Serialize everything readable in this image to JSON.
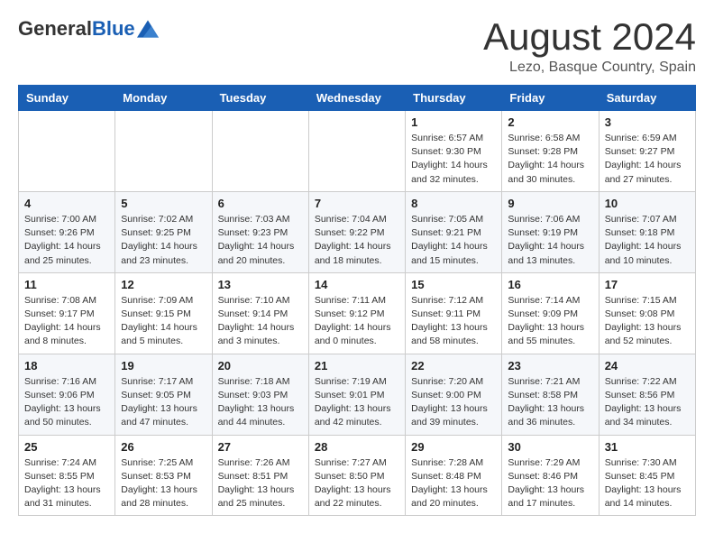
{
  "logo": {
    "general": "General",
    "blue": "Blue"
  },
  "title": "August 2024",
  "location": "Lezo, Basque Country, Spain",
  "days_header": [
    "Sunday",
    "Monday",
    "Tuesday",
    "Wednesday",
    "Thursday",
    "Friday",
    "Saturday"
  ],
  "weeks": [
    [
      {
        "day": "",
        "info": ""
      },
      {
        "day": "",
        "info": ""
      },
      {
        "day": "",
        "info": ""
      },
      {
        "day": "",
        "info": ""
      },
      {
        "day": "1",
        "info": "Sunrise: 6:57 AM\nSunset: 9:30 PM\nDaylight: 14 hours\nand 32 minutes."
      },
      {
        "day": "2",
        "info": "Sunrise: 6:58 AM\nSunset: 9:28 PM\nDaylight: 14 hours\nand 30 minutes."
      },
      {
        "day": "3",
        "info": "Sunrise: 6:59 AM\nSunset: 9:27 PM\nDaylight: 14 hours\nand 27 minutes."
      }
    ],
    [
      {
        "day": "4",
        "info": "Sunrise: 7:00 AM\nSunset: 9:26 PM\nDaylight: 14 hours\nand 25 minutes."
      },
      {
        "day": "5",
        "info": "Sunrise: 7:02 AM\nSunset: 9:25 PM\nDaylight: 14 hours\nand 23 minutes."
      },
      {
        "day": "6",
        "info": "Sunrise: 7:03 AM\nSunset: 9:23 PM\nDaylight: 14 hours\nand 20 minutes."
      },
      {
        "day": "7",
        "info": "Sunrise: 7:04 AM\nSunset: 9:22 PM\nDaylight: 14 hours\nand 18 minutes."
      },
      {
        "day": "8",
        "info": "Sunrise: 7:05 AM\nSunset: 9:21 PM\nDaylight: 14 hours\nand 15 minutes."
      },
      {
        "day": "9",
        "info": "Sunrise: 7:06 AM\nSunset: 9:19 PM\nDaylight: 14 hours\nand 13 minutes."
      },
      {
        "day": "10",
        "info": "Sunrise: 7:07 AM\nSunset: 9:18 PM\nDaylight: 14 hours\nand 10 minutes."
      }
    ],
    [
      {
        "day": "11",
        "info": "Sunrise: 7:08 AM\nSunset: 9:17 PM\nDaylight: 14 hours\nand 8 minutes."
      },
      {
        "day": "12",
        "info": "Sunrise: 7:09 AM\nSunset: 9:15 PM\nDaylight: 14 hours\nand 5 minutes."
      },
      {
        "day": "13",
        "info": "Sunrise: 7:10 AM\nSunset: 9:14 PM\nDaylight: 14 hours\nand 3 minutes."
      },
      {
        "day": "14",
        "info": "Sunrise: 7:11 AM\nSunset: 9:12 PM\nDaylight: 14 hours\nand 0 minutes."
      },
      {
        "day": "15",
        "info": "Sunrise: 7:12 AM\nSunset: 9:11 PM\nDaylight: 13 hours\nand 58 minutes."
      },
      {
        "day": "16",
        "info": "Sunrise: 7:14 AM\nSunset: 9:09 PM\nDaylight: 13 hours\nand 55 minutes."
      },
      {
        "day": "17",
        "info": "Sunrise: 7:15 AM\nSunset: 9:08 PM\nDaylight: 13 hours\nand 52 minutes."
      }
    ],
    [
      {
        "day": "18",
        "info": "Sunrise: 7:16 AM\nSunset: 9:06 PM\nDaylight: 13 hours\nand 50 minutes."
      },
      {
        "day": "19",
        "info": "Sunrise: 7:17 AM\nSunset: 9:05 PM\nDaylight: 13 hours\nand 47 minutes."
      },
      {
        "day": "20",
        "info": "Sunrise: 7:18 AM\nSunset: 9:03 PM\nDaylight: 13 hours\nand 44 minutes."
      },
      {
        "day": "21",
        "info": "Sunrise: 7:19 AM\nSunset: 9:01 PM\nDaylight: 13 hours\nand 42 minutes."
      },
      {
        "day": "22",
        "info": "Sunrise: 7:20 AM\nSunset: 9:00 PM\nDaylight: 13 hours\nand 39 minutes."
      },
      {
        "day": "23",
        "info": "Sunrise: 7:21 AM\nSunset: 8:58 PM\nDaylight: 13 hours\nand 36 minutes."
      },
      {
        "day": "24",
        "info": "Sunrise: 7:22 AM\nSunset: 8:56 PM\nDaylight: 13 hours\nand 34 minutes."
      }
    ],
    [
      {
        "day": "25",
        "info": "Sunrise: 7:24 AM\nSunset: 8:55 PM\nDaylight: 13 hours\nand 31 minutes."
      },
      {
        "day": "26",
        "info": "Sunrise: 7:25 AM\nSunset: 8:53 PM\nDaylight: 13 hours\nand 28 minutes."
      },
      {
        "day": "27",
        "info": "Sunrise: 7:26 AM\nSunset: 8:51 PM\nDaylight: 13 hours\nand 25 minutes."
      },
      {
        "day": "28",
        "info": "Sunrise: 7:27 AM\nSunset: 8:50 PM\nDaylight: 13 hours\nand 22 minutes."
      },
      {
        "day": "29",
        "info": "Sunrise: 7:28 AM\nSunset: 8:48 PM\nDaylight: 13 hours\nand 20 minutes."
      },
      {
        "day": "30",
        "info": "Sunrise: 7:29 AM\nSunset: 8:46 PM\nDaylight: 13 hours\nand 17 minutes."
      },
      {
        "day": "31",
        "info": "Sunrise: 7:30 AM\nSunset: 8:45 PM\nDaylight: 13 hours\nand 14 minutes."
      }
    ]
  ]
}
